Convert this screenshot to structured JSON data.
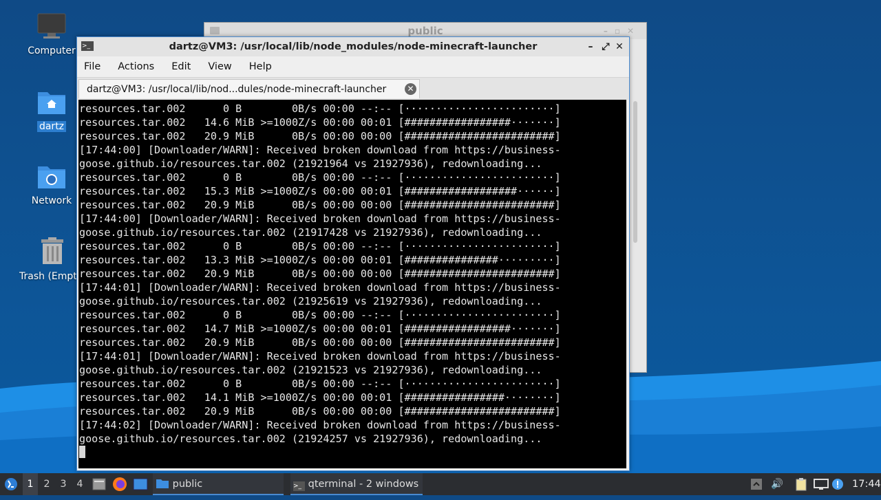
{
  "desktop": {
    "icons": [
      {
        "label": "Computer"
      },
      {
        "label": "dartz"
      },
      {
        "label": "Network"
      },
      {
        "label": "Trash (Empt"
      }
    ]
  },
  "background_window": {
    "title": "public"
  },
  "terminal": {
    "title": "dartz@VM3: /usr/local/lib/node_modules/node-minecraft-launcher",
    "menu": [
      "File",
      "Actions",
      "Edit",
      "View",
      "Help"
    ],
    "tab_label": "dartz@VM3: /usr/local/lib/nod...dules/node-minecraft-launcher",
    "lines": [
      "resources.tar.002      0 B        0B/s 00:00 --:-- [························]",
      "resources.tar.002   14.6 MiB >=1000Z/s 00:00 00:01 [#################·······]",
      "resources.tar.002   20.9 MiB      0B/s 00:00 00:00 [########################]",
      "[17:44:00] [Downloader/WARN]: Received broken download from https://business-",
      "goose.github.io/resources.tar.002 (21921964 vs 21927936), redownloading...",
      "resources.tar.002      0 B        0B/s 00:00 --:-- [························]",
      "resources.tar.002   15.3 MiB >=1000Z/s 00:00 00:01 [##################······]",
      "resources.tar.002   20.9 MiB      0B/s 00:00 00:00 [########################]",
      "[17:44:00] [Downloader/WARN]: Received broken download from https://business-",
      "goose.github.io/resources.tar.002 (21917428 vs 21927936), redownloading...",
      "resources.tar.002      0 B        0B/s 00:00 --:-- [························]",
      "resources.tar.002   13.3 MiB >=1000Z/s 00:00 00:01 [###############·········]",
      "resources.tar.002   20.9 MiB      0B/s 00:00 00:00 [########################]",
      "[17:44:01] [Downloader/WARN]: Received broken download from https://business-",
      "goose.github.io/resources.tar.002 (21925619 vs 21927936), redownloading...",
      "resources.tar.002      0 B        0B/s 00:00 --:-- [························]",
      "resources.tar.002   14.7 MiB >=1000Z/s 00:00 00:01 [#################·······]",
      "resources.tar.002   20.9 MiB      0B/s 00:00 00:00 [########################]",
      "[17:44:01] [Downloader/WARN]: Received broken download from https://business-",
      "goose.github.io/resources.tar.002 (21921523 vs 21927936), redownloading...",
      "resources.tar.002      0 B        0B/s 00:00 --:-- [························]",
      "resources.tar.002   14.1 MiB >=1000Z/s 00:00 00:01 [################········]",
      "resources.tar.002   20.9 MiB      0B/s 00:00 00:00 [########################]",
      "[17:44:02] [Downloader/WARN]: Received broken download from https://business-",
      "goose.github.io/resources.tar.002 (21924257 vs 21927936), redownloading..."
    ]
  },
  "taskbar": {
    "workspaces": [
      "1",
      "2",
      "3",
      "4"
    ],
    "active_workspace": "1",
    "windows": [
      {
        "label": "public"
      },
      {
        "label": "qterminal - 2 windows"
      }
    ],
    "clock": "17:44"
  },
  "colors": {
    "desktop_bg": "#0f4a86",
    "terminal_bg": "#000000",
    "accent": "#4a8bd0",
    "taskbar_bg": "#2b2d31"
  }
}
